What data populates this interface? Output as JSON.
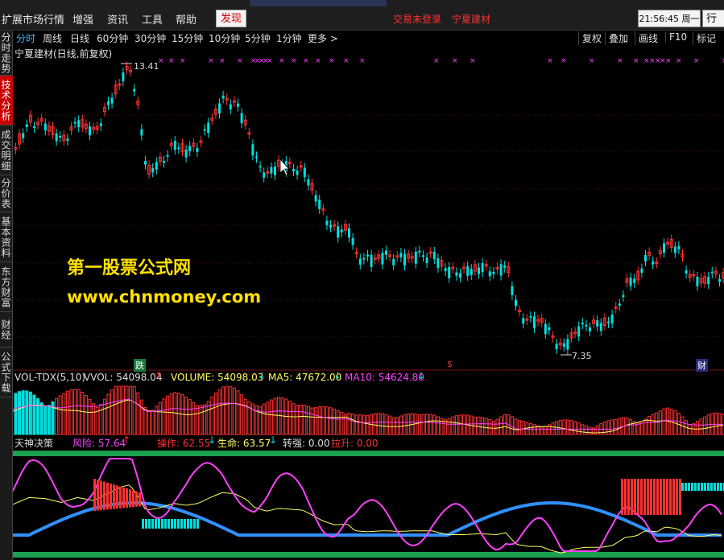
{
  "menu": {
    "items": [
      "扩展市场行情",
      "增强",
      "资讯",
      "工具",
      "帮助"
    ],
    "discover": "发现",
    "status": "交易未登录",
    "stock_name": "宁夏建材",
    "clock": "21:56:45 周一",
    "quote": "行情"
  },
  "sidebar": {
    "tabs": [
      "分时走势",
      "技术分析",
      "成交明细",
      "分价表",
      "基本资料",
      "东方财富",
      "财经",
      "公式下载"
    ]
  },
  "toolbar": {
    "periods": [
      "分时",
      "周线",
      "日线",
      "60分钟",
      "30分钟",
      "15分钟",
      "10分钟",
      "5分钟",
      "1分钟",
      "更多 >"
    ],
    "tools": [
      "复权",
      "叠加",
      "画线",
      "F10",
      "标记"
    ]
  },
  "main": {
    "title": "宁夏建材(日线,前复权)",
    "high_label": "13.41",
    "low_label": "7.35",
    "marker_die": "跌",
    "marker_s": "$",
    "marker_cai": "财"
  },
  "watermark": {
    "line1": "第一股票公式网",
    "line2": "www.chnmoney.com"
  },
  "volume": {
    "name": "VOL-TDX(5,10)",
    "vol_label": "VVOL: 54098.04",
    "volume_label": "VOLUME: 54098.03",
    "ma5_label": "MA5: 47672.00",
    "ma10_label": "MA10: 54624.80"
  },
  "indicator": {
    "name": "天神决策",
    "risk_label": "风险: 57.64",
    "op_label": "操作: 62.55",
    "life_label": "生命: 63.57",
    "turn_label": "转强: 0.00",
    "pull_label": "拉升: 0.00"
  },
  "colors": {
    "up": "#ff3232",
    "down": "#00e0e0",
    "ma5": "#ffff60",
    "ma10": "#ff40ff",
    "life": "#3090ff",
    "band": "#1aa050"
  }
}
